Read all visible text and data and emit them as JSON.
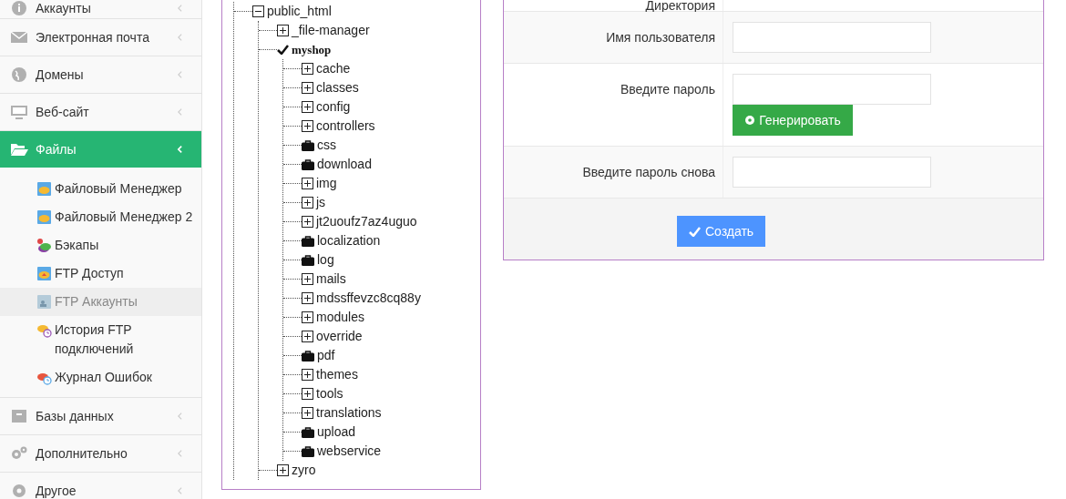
{
  "sidebar": {
    "items": [
      {
        "label": "Аккаунты",
        "selected": false,
        "expanded": false
      },
      {
        "label": "Электронная почта",
        "selected": false,
        "expanded": false
      },
      {
        "label": "Домены",
        "selected": false,
        "expanded": false
      },
      {
        "label": "Веб-сайт",
        "selected": false,
        "expanded": false
      },
      {
        "label": "Файлы",
        "selected": true,
        "expanded": true,
        "children": [
          {
            "label": "Файловый Менеджер",
            "selected": false
          },
          {
            "label": "Файловый Менеджер 2",
            "selected": false
          },
          {
            "label": "Бэкапы",
            "selected": false
          },
          {
            "label": "FTP Доступ",
            "selected": false
          },
          {
            "label": "FTP Аккаунты",
            "selected": true
          },
          {
            "label": "История FTP подключений",
            "selected": false
          },
          {
            "label": "Журнал Ошибок",
            "selected": false
          }
        ]
      },
      {
        "label": "Базы данных",
        "selected": false,
        "expanded": false
      },
      {
        "label": "Дополнительно",
        "selected": false,
        "expanded": false
      },
      {
        "label": "Другое",
        "selected": false,
        "expanded": false
      }
    ]
  },
  "tree": [
    {
      "name": "public_html",
      "kind": "expandable",
      "expanded": true,
      "selected": false,
      "children": [
        {
          "name": "_file-manager",
          "kind": "expandable",
          "expanded": false,
          "selected": false
        },
        {
          "name": "myshop",
          "kind": "expandable",
          "expanded": true,
          "selected": true,
          "children": [
            {
              "name": "cache",
              "kind": "expandable",
              "expanded": false,
              "selected": false
            },
            {
              "name": "classes",
              "kind": "expandable",
              "expanded": false,
              "selected": false
            },
            {
              "name": "config",
              "kind": "expandable",
              "expanded": false,
              "selected": false
            },
            {
              "name": "controllers",
              "kind": "expandable",
              "expanded": false,
              "selected": false
            },
            {
              "name": "css",
              "kind": "empty",
              "selected": false
            },
            {
              "name": "download",
              "kind": "empty",
              "selected": false
            },
            {
              "name": "img",
              "kind": "expandable",
              "expanded": false,
              "selected": false
            },
            {
              "name": "js",
              "kind": "expandable",
              "expanded": false,
              "selected": false
            },
            {
              "name": "jt2uoufz7az4uguo",
              "kind": "expandable",
              "expanded": false,
              "selected": false
            },
            {
              "name": "localization",
              "kind": "empty",
              "selected": false
            },
            {
              "name": "log",
              "kind": "empty",
              "selected": false
            },
            {
              "name": "mails",
              "kind": "expandable",
              "expanded": false,
              "selected": false
            },
            {
              "name": "mdssffevzc8cq88y",
              "kind": "expandable",
              "expanded": false,
              "selected": false
            },
            {
              "name": "modules",
              "kind": "expandable",
              "expanded": false,
              "selected": false
            },
            {
              "name": "override",
              "kind": "expandable",
              "expanded": false,
              "selected": false
            },
            {
              "name": "pdf",
              "kind": "empty",
              "selected": false
            },
            {
              "name": "themes",
              "kind": "expandable",
              "expanded": false,
              "selected": false
            },
            {
              "name": "tools",
              "kind": "expandable",
              "expanded": false,
              "selected": false
            },
            {
              "name": "translations",
              "kind": "expandable",
              "expanded": false,
              "selected": false
            },
            {
              "name": "upload",
              "kind": "empty",
              "selected": false
            },
            {
              "name": "webservice",
              "kind": "empty",
              "selected": false
            }
          ]
        },
        {
          "name": "zyro",
          "kind": "expandable",
          "expanded": false,
          "selected": false
        }
      ]
    }
  ],
  "form": {
    "rows": [
      {
        "kind": "label_only",
        "label": "Директория"
      },
      {
        "kind": "input",
        "label": "Имя пользователя"
      },
      {
        "kind": "input_generate",
        "label": "Введите пароль",
        "button": "Генерировать"
      },
      {
        "kind": "input",
        "label": "Введите пароль снова"
      }
    ],
    "submit": "Создать"
  }
}
